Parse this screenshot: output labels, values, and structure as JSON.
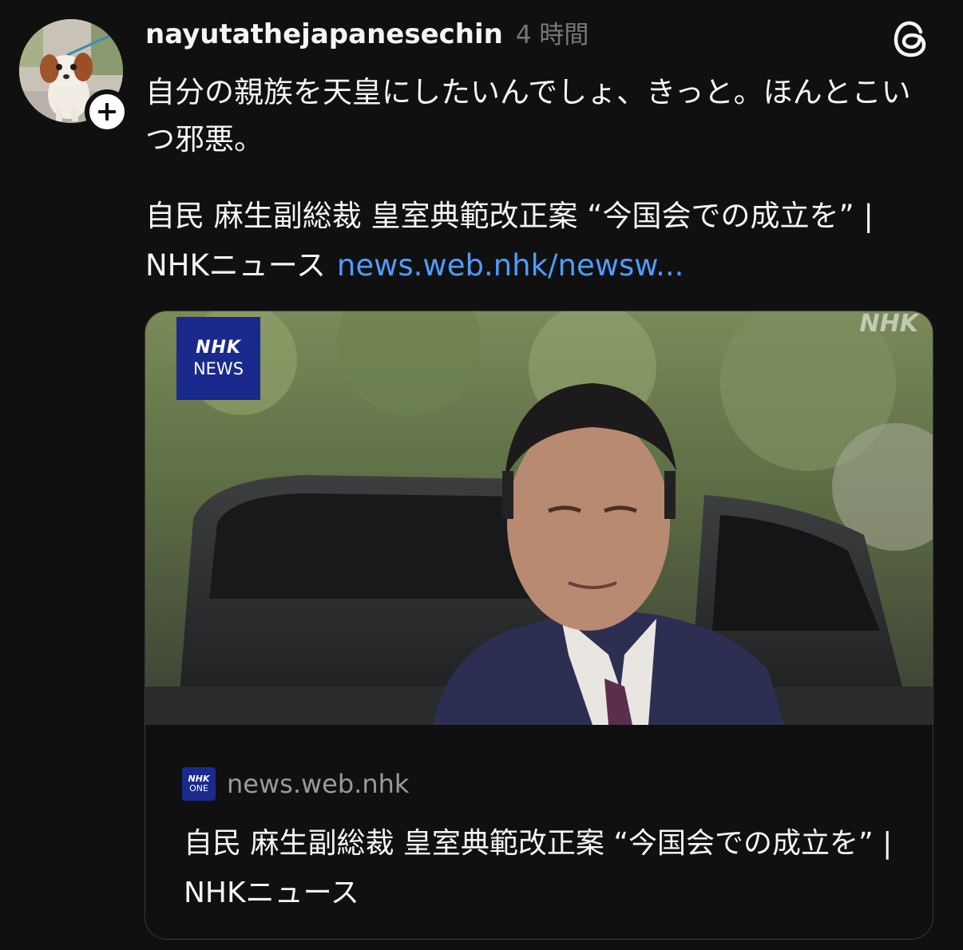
{
  "post": {
    "username": "nayutathejapanesechin",
    "timestamp": "4 時間",
    "body": "自分の親族を天皇にしたいんでしょ、きっと。ほんとこいつ邪悪。",
    "link_text": "自民 麻生副総裁 皇室典範改正案 “今国会での成立を” | NHKニュース",
    "link_url": "news.web.nhk/newsw..."
  },
  "icons": {
    "follow": "plus-icon",
    "app": "threads-logo-icon"
  },
  "card": {
    "image_logo_top": "NHK",
    "image_logo_bottom": "NEWS",
    "watermark": "NHK",
    "source_icon_top": "NHK",
    "source_icon_bottom": "ONE",
    "domain": "news.web.nhk",
    "title": "自民 麻生副総裁 皇室典範改正案 “今国会での成立を” | NHKニュース"
  },
  "colors": {
    "background": "#101010",
    "text": "#f3f5f7",
    "muted": "#777777",
    "link": "#4d9dff",
    "nhk_blue": "#1a2a8c"
  }
}
